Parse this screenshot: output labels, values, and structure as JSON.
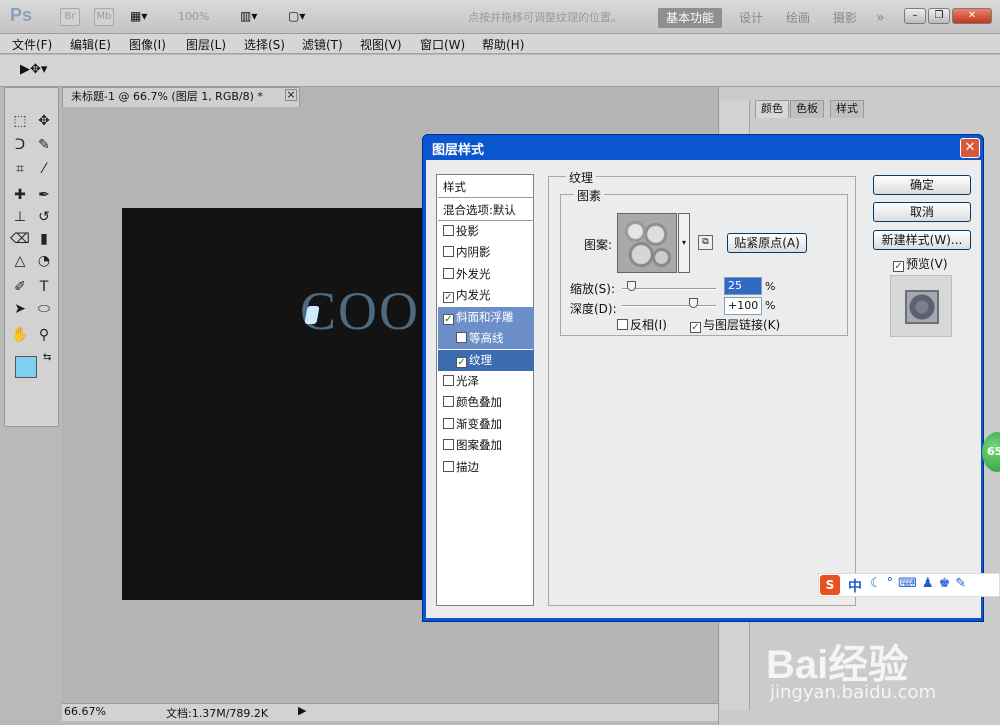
{
  "app": {
    "logo": "Ps",
    "bar_buttons": [
      "Br",
      "Mb"
    ],
    "zoom_select": "100%",
    "workspaces": [
      "基本功能",
      "设计",
      "绘画",
      "摄影"
    ],
    "more": "»",
    "window_buttons": [
      "–",
      "❐",
      "✕"
    ]
  },
  "menubar": [
    "文件(F)",
    "编辑(E)",
    "图像(I)",
    "图层(L)",
    "选择(S)",
    "滤镜(T)",
    "视图(V)",
    "窗口(W)",
    "帮助(H)"
  ],
  "options_bar": {
    "hint": "点按并拖移可调整纹理的位置。"
  },
  "document": {
    "tab_title": "未标题-1 @ 66.7% (图层 1, RGB/8) *",
    "tab_close": "×",
    "canvas_text": "COO",
    "status_zoom": "66.67%",
    "status_doc": "文档:1.37M/789.2K"
  },
  "right_panel": {
    "tabs": [
      "颜色",
      "色板",
      "样式"
    ]
  },
  "dialog": {
    "title": "图层样式",
    "close": "✕",
    "style_list": [
      {
        "label": "样式",
        "type": "header"
      },
      {
        "label": "混合选项:默认",
        "type": "header"
      },
      {
        "label": "投影",
        "checked": false
      },
      {
        "label": "内阴影",
        "checked": false
      },
      {
        "label": "外发光",
        "checked": false
      },
      {
        "label": "内发光",
        "checked": true
      },
      {
        "label": "斜面和浮雕",
        "checked": true,
        "selected": true
      },
      {
        "label": "等高线",
        "checked": false,
        "sub": true
      },
      {
        "label": "纹理",
        "checked": true,
        "sub": true,
        "active": true
      },
      {
        "label": "光泽",
        "checked": false
      },
      {
        "label": "颜色叠加",
        "checked": false
      },
      {
        "label": "渐变叠加",
        "checked": false
      },
      {
        "label": "图案叠加",
        "checked": false
      },
      {
        "label": "描边",
        "checked": false
      }
    ],
    "texture": {
      "group_title": "纹理",
      "pattern_group": "图素",
      "pattern_label": "图案:",
      "snap_origin": "贴紧原点(A)",
      "scale_label": "缩放(S):",
      "scale_value": "25",
      "scale_level": 0.1,
      "depth_label": "深度(D):",
      "depth_value": "+100",
      "depth_level": 0.75,
      "percent": "%",
      "invert_label": "反相(I)",
      "invert_checked": false,
      "link_label": "与图层链接(K)",
      "link_checked": true
    },
    "buttons": {
      "ok": "确定",
      "cancel": "取消",
      "new_style": "新建样式(W)...",
      "preview_label": "预览(V)",
      "preview_checked": true
    }
  },
  "ime": {
    "logo": "S",
    "lang": "中"
  },
  "watermark": {
    "text": "Bai经验",
    "url": "jingyan.baidu.com"
  },
  "badge": "65"
}
